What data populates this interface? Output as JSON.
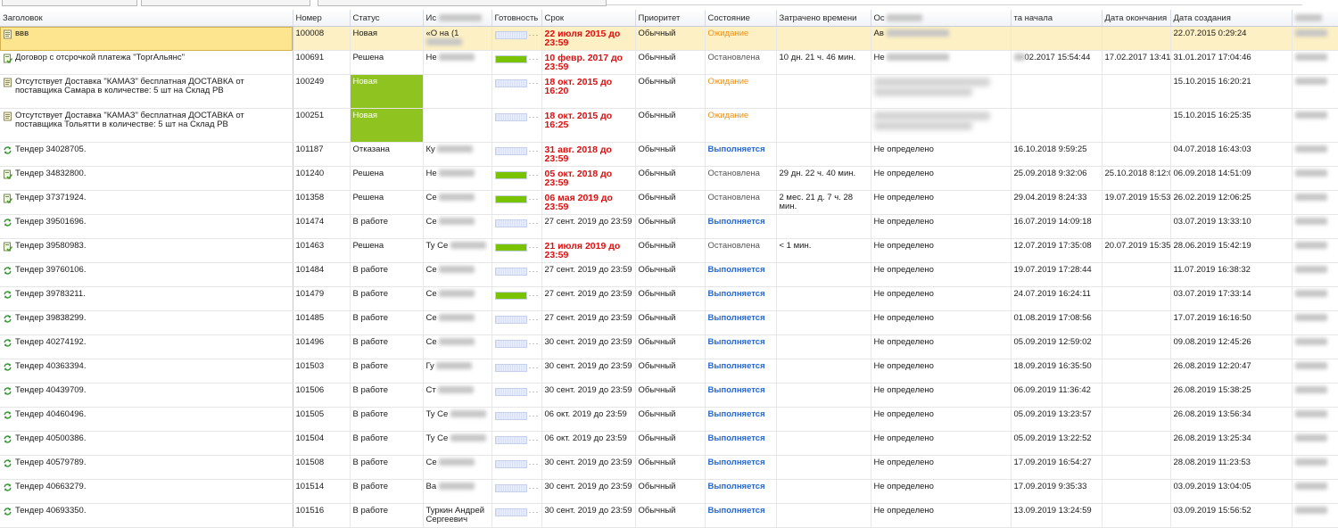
{
  "columns": {
    "title": "Заголовок",
    "number": "Номер",
    "status": "Статус",
    "executor": "Ис",
    "ready": "Готовность",
    "deadline": "Срок",
    "priority": "Приоритет",
    "condition": "Состояние",
    "spent": "Затрачено времени",
    "basis": "Ос",
    "start": "та начала",
    "end": "Дата окончания",
    "created": "Дата создания"
  },
  "rows": [
    {
      "title": "ввв",
      "icon": "note",
      "number": "100008",
      "status": "Новая",
      "status_style": "new",
      "executor": "«О на (1",
      "progress": 0,
      "deadline": "22 июля 2015 до 23:59",
      "deadline_overdue": true,
      "priority": "Обычный",
      "condition": "Ожидание",
      "condition_style": "wait",
      "spent": "",
      "basis": "Ав",
      "start": "",
      "end": "",
      "created": "22.07.2015 0:29:24",
      "selected": true
    },
    {
      "title": "Договор с отсрочкой платежа \"ТоргАльянс\"",
      "icon": "doc-check",
      "number": "100691",
      "status": "Решена",
      "status_style": "",
      "executor": "Не",
      "progress": 100,
      "deadline": "10 февр. 2017 до 23:59",
      "deadline_overdue": true,
      "priority": "Обычный",
      "condition": "Остановлена",
      "condition_style": "stop",
      "spent": "10 дн. 21 ч. 46 мин.",
      "basis": "Не",
      "start": "02.2017 15:54:44",
      "end": "17.02.2017 13:41:29",
      "created": "31.01.2017 17:04:46"
    },
    {
      "title": "Отсутствует Доставка \"КАМАЗ\"   бесплатная ДОСТАВКА от поставщика Самара в количестве: 5 шт на  Склад РВ",
      "icon": "note",
      "number": "100249",
      "status": "Новая",
      "status_style": "new-strong",
      "executor": "",
      "progress": 0,
      "deadline": "18 окт. 2015 до 16:20",
      "deadline_overdue": true,
      "priority": "Обычный",
      "condition": "Ожидание",
      "condition_style": "wait",
      "spent": "",
      "basis": "",
      "start": "",
      "end": "",
      "created": "15.10.2015 16:20:21"
    },
    {
      "title": "Отсутствует Доставка \"КАМАЗ\"   бесплатная ДОСТАВКА от поставщика Тольятти в количестве: 5 шт на  Склад РВ",
      "icon": "note",
      "number": "100251",
      "status": "Новая",
      "status_style": "new-strong",
      "executor": "",
      "progress": 0,
      "deadline": "18 окт. 2015 до 16:25",
      "deadline_overdue": true,
      "priority": "Обычный",
      "condition": "Ожидание",
      "condition_style": "wait",
      "spent": "",
      "basis": "",
      "start": "",
      "end": "",
      "created": "15.10.2015 16:25:35"
    },
    {
      "title": "Тендер 34028705.",
      "icon": "refresh",
      "number": "101187",
      "status": "Отказана",
      "status_style": "",
      "executor": "Ку",
      "progress": 0,
      "deadline": "31 авг. 2018 до 23:59",
      "deadline_overdue": true,
      "priority": "Обычный",
      "condition": "Выполняется",
      "condition_style": "run",
      "spent": "",
      "basis": "Не определено",
      "start": "16.10.2018 9:59:25",
      "end": "",
      "created": "04.07.2018 16:43:03"
    },
    {
      "title": "Тендер 34832800.",
      "icon": "doc-check",
      "number": "101240",
      "status": "Решена",
      "status_style": "",
      "executor": "Не",
      "progress": 100,
      "deadline": "05 окт. 2018 до 23:59",
      "deadline_overdue": true,
      "priority": "Обычный",
      "condition": "Остановлена",
      "condition_style": "stop",
      "spent": "29 дн. 22 ч. 40 мин.",
      "basis": "Не определено",
      "start": "25.09.2018 9:32:06",
      "end": "25.10.2018 8:12:07",
      "created": "06.09.2018 14:51:09"
    },
    {
      "title": "Тендер 37371924.",
      "icon": "doc-check",
      "number": "101358",
      "status": "Решена",
      "status_style": "",
      "executor": "Се",
      "progress": 100,
      "deadline": "06 мая 2019 до 23:59",
      "deadline_overdue": true,
      "priority": "Обычный",
      "condition": "Остановлена",
      "condition_style": "stop",
      "spent": "2 мес. 21 д. 7 ч. 28 мин.",
      "basis": "Не определено",
      "start": "29.04.2019 8:24:33",
      "end": "19.07.2019 15:53:29",
      "created": "26.02.2019 12:06:25"
    },
    {
      "title": "Тендер 39501696.",
      "icon": "refresh",
      "number": "101474",
      "status": "В работе",
      "status_style": "",
      "executor": "Се",
      "progress": 0,
      "deadline": "27 сент. 2019 до 23:59",
      "deadline_overdue": false,
      "priority": "Обычный",
      "condition": "Выполняется",
      "condition_style": "run",
      "spent": "",
      "basis": "Не определено",
      "start": "16.07.2019 14:09:18",
      "end": "",
      "created": "03.07.2019 13:33:10"
    },
    {
      "title": "Тендер 39580983.",
      "icon": "doc-check",
      "number": "101463",
      "status": "Решена",
      "status_style": "",
      "executor": "Ту Се",
      "progress": 100,
      "deadline": "21 июля 2019 до 23:59",
      "deadline_overdue": true,
      "priority": "Обычный",
      "condition": "Остановлена",
      "condition_style": "stop",
      "spent": "< 1 мин.",
      "basis": "Не определено",
      "start": "12.07.2019 17:35:08",
      "end": "20.07.2019 15:35:53",
      "created": "28.06.2019 15:42:19"
    },
    {
      "title": "Тендер 39760106.",
      "icon": "refresh",
      "number": "101484",
      "status": "В работе",
      "status_style": "",
      "executor": "Се",
      "progress": 0,
      "deadline": "27 сент. 2019 до 23:59",
      "deadline_overdue": false,
      "priority": "Обычный",
      "condition": "Выполняется",
      "condition_style": "run",
      "spent": "",
      "basis": "Не определено",
      "start": "19.07.2019 17:28:44",
      "end": "",
      "created": "11.07.2019 16:38:32"
    },
    {
      "title": "Тендер 39783211.",
      "icon": "refresh",
      "number": "101479",
      "status": "В работе",
      "status_style": "",
      "executor": "Се",
      "progress": 100,
      "deadline": "27 сент. 2019 до 23:59",
      "deadline_overdue": false,
      "priority": "Обычный",
      "condition": "Выполняется",
      "condition_style": "run",
      "spent": "",
      "basis": "Не определено",
      "start": "24.07.2019 16:24:11",
      "end": "",
      "created": "03.07.2019 17:33:14"
    },
    {
      "title": "Тендер 39838299.",
      "icon": "refresh",
      "number": "101485",
      "status": "В работе",
      "status_style": "",
      "executor": "Се",
      "progress": 0,
      "deadline": "27 сент. 2019 до 23:59",
      "deadline_overdue": false,
      "priority": "Обычный",
      "condition": "Выполняется",
      "condition_style": "run",
      "spent": "",
      "basis": "Не определено",
      "start": "01.08.2019 17:08:56",
      "end": "",
      "created": "17.07.2019 16:16:50"
    },
    {
      "title": "Тендер 40274192.",
      "icon": "refresh",
      "number": "101496",
      "status": "В работе",
      "status_style": "",
      "executor": "Се",
      "progress": 0,
      "deadline": "30 сент. 2019 до 23:59",
      "deadline_overdue": false,
      "priority": "Обычный",
      "condition": "Выполняется",
      "condition_style": "run",
      "spent": "",
      "basis": "Не определено",
      "start": "05.09.2019 12:59:02",
      "end": "",
      "created": "09.08.2019 12:45:26"
    },
    {
      "title": "Тендер 40363394.",
      "icon": "refresh",
      "number": "101503",
      "status": "В работе",
      "status_style": "",
      "executor": "Гу",
      "progress": 0,
      "deadline": "30 сент. 2019 до 23:59",
      "deadline_overdue": false,
      "priority": "Обычный",
      "condition": "Выполняется",
      "condition_style": "run",
      "spent": "",
      "basis": "Не определено",
      "start": "18.09.2019 16:35:50",
      "end": "",
      "created": "26.08.2019 12:20:47"
    },
    {
      "title": "Тендер 40439709.",
      "icon": "refresh",
      "number": "101506",
      "status": "В работе",
      "status_style": "",
      "executor": "Ст",
      "progress": 0,
      "deadline": "30 сент. 2019 до 23:59",
      "deadline_overdue": false,
      "priority": "Обычный",
      "condition": "Выполняется",
      "condition_style": "run",
      "spent": "",
      "basis": "Не определено",
      "start": "06.09.2019 11:36:42",
      "end": "",
      "created": "26.08.2019 15:38:25"
    },
    {
      "title": "Тендер 40460496.",
      "icon": "refresh",
      "number": "101505",
      "status": "В работе",
      "status_style": "",
      "executor": "Ту Се",
      "progress": 0,
      "deadline": "06 окт. 2019 до 23:59",
      "deadline_overdue": false,
      "priority": "Обычный",
      "condition": "Выполняется",
      "condition_style": "run",
      "spent": "",
      "basis": "Не определено",
      "start": "05.09.2019 13:23:57",
      "end": "",
      "created": "26.08.2019 13:56:34"
    },
    {
      "title": "Тендер 40500386.",
      "icon": "refresh",
      "number": "101504",
      "status": "В работе",
      "status_style": "",
      "executor": "Ту Се",
      "progress": 0,
      "deadline": "06 окт. 2019 до 23:59",
      "deadline_overdue": false,
      "priority": "Обычный",
      "condition": "Выполняется",
      "condition_style": "run",
      "spent": "",
      "basis": "Не определено",
      "start": "05.09.2019 13:22:52",
      "end": "",
      "created": "26.08.2019 13:25:34"
    },
    {
      "title": "Тендер 40579789.",
      "icon": "refresh",
      "number": "101508",
      "status": "В работе",
      "status_style": "",
      "executor": "Се",
      "progress": 0,
      "deadline": "30 сент. 2019 до 23:59",
      "deadline_overdue": false,
      "priority": "Обычный",
      "condition": "Выполняется",
      "condition_style": "run",
      "spent": "",
      "basis": "Не определено",
      "start": "17.09.2019 16:54:27",
      "end": "",
      "created": "28.08.2019 11:23:53"
    },
    {
      "title": "Тендер 40663279.",
      "icon": "refresh",
      "number": "101514",
      "status": "В работе",
      "status_style": "",
      "executor": "Ва",
      "progress": 0,
      "deadline": "30 сент. 2019 до 23:59",
      "deadline_overdue": false,
      "priority": "Обычный",
      "condition": "Выполняется",
      "condition_style": "run",
      "spent": "",
      "basis": "Не определено",
      "start": "17.09.2019 9:35:33",
      "end": "",
      "created": "03.09.2019 13:04:05"
    },
    {
      "title": "Тендер 40693350.",
      "icon": "refresh",
      "number": "101516",
      "status": "В работе",
      "status_style": "",
      "executor": "Туркин Андрей Сергеевич",
      "progress": 0,
      "deadline": "30 сент. 2019 до 23:59",
      "deadline_overdue": false,
      "priority": "Обычный",
      "condition": "Выполняется",
      "condition_style": "run",
      "spent": "",
      "basis": "Не определено",
      "start": "13.09.2019 13:24:59",
      "end": "",
      "created": "03.09.2019 15:56:52"
    }
  ]
}
